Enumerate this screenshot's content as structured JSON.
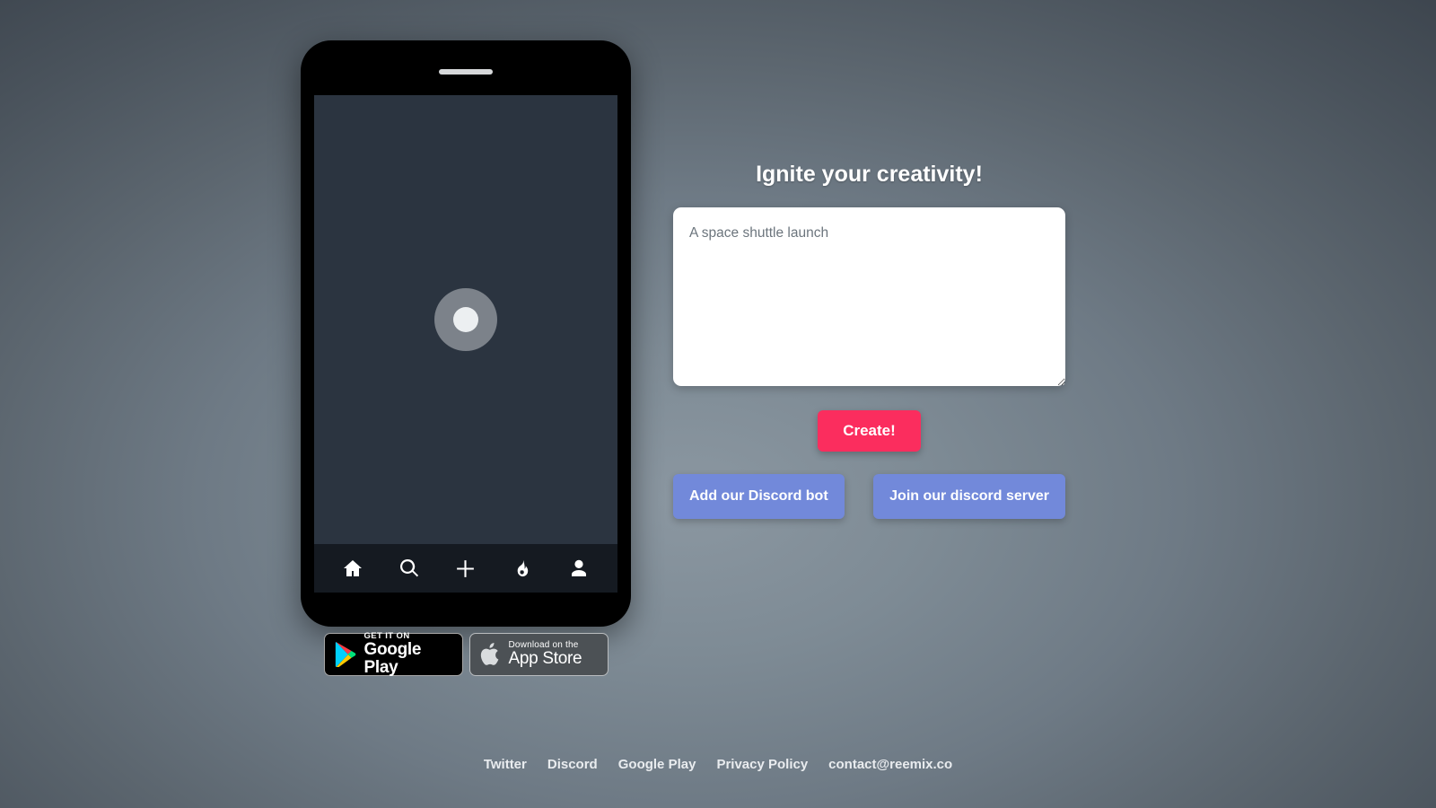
{
  "phone": {
    "status": "loading",
    "nav": [
      {
        "name": "home-icon",
        "label": "Home"
      },
      {
        "name": "search-icon",
        "label": "Search"
      },
      {
        "name": "plus-icon",
        "label": "Create"
      },
      {
        "name": "fire-icon",
        "label": "Trending"
      },
      {
        "name": "person-icon",
        "label": "Profile"
      }
    ]
  },
  "badges": {
    "google_play": {
      "top": "GET IT ON",
      "bottom": "Google Play"
    },
    "app_store": {
      "top": "Download on the",
      "bottom": "App Store"
    }
  },
  "panel": {
    "title": "Ignite your creativity!",
    "prompt_value": "A space shuttle launch",
    "prompt_placeholder": "A space shuttle launch",
    "create_label": "Create!",
    "discord_bot_label": "Add our Discord bot",
    "discord_server_label": "Join our discord server"
  },
  "footer": {
    "links": [
      {
        "label": "Twitter"
      },
      {
        "label": "Discord"
      },
      {
        "label": "Google Play"
      },
      {
        "label": "Privacy Policy"
      },
      {
        "label": "contact@reemix.co"
      }
    ]
  },
  "colors": {
    "accent_create": "#fb2d5e",
    "discord_blurple": "#7289da",
    "phone_screen": "#2b3440",
    "phone_nav": "#151a21",
    "background_center": "#8b97a1",
    "background_edge": "#343a41"
  }
}
